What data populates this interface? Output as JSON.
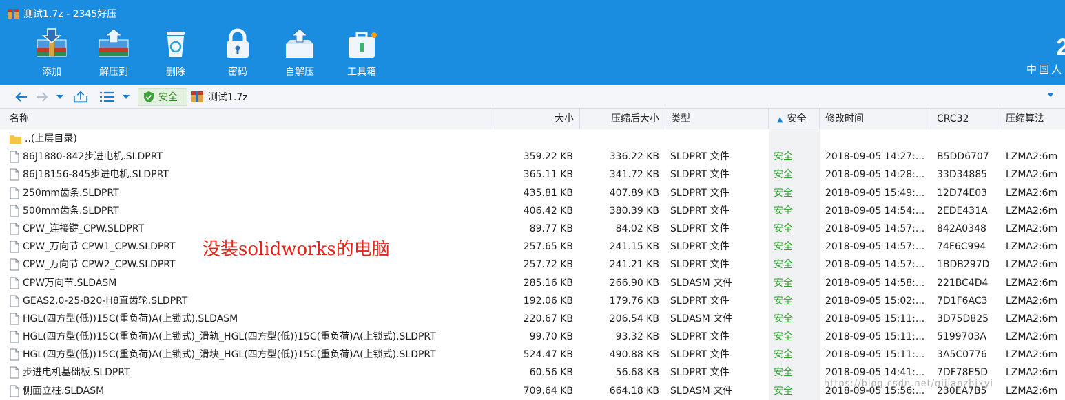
{
  "window": {
    "title": "测试1.7z - 2345好压"
  },
  "toolbar": {
    "buttons": [
      {
        "label": "添加",
        "icon": "add-archive-icon"
      },
      {
        "label": "解压到",
        "icon": "extract-to-icon"
      },
      {
        "label": "删除",
        "icon": "delete-icon"
      },
      {
        "label": "密码",
        "icon": "lock-icon"
      },
      {
        "label": "自解压",
        "icon": "self-extract-icon"
      },
      {
        "label": "工具箱",
        "icon": "toolbox-icon"
      }
    ]
  },
  "brand": {
    "number": "2",
    "text": "中国人"
  },
  "addressbar": {
    "safe_label": "安全",
    "path": "测试1.7z"
  },
  "columns": {
    "name": "名称",
    "size": "大小",
    "compressed": "压缩后大小",
    "type": "类型",
    "safety": "安全",
    "modified": "修改时间",
    "crc": "CRC32",
    "method": "压缩算法"
  },
  "parent_row": {
    "name": "..(上层目录)"
  },
  "rows": [
    {
      "name": "86J1880-842步进电机.SLDPRT",
      "size": "359.22 KB",
      "csize": "336.22 KB",
      "type": "SLDPRT 文件",
      "safe": "安全",
      "time": "2018-09-05 14:27:...",
      "crc": "B5DD6707",
      "method": "LZMA2:6m"
    },
    {
      "name": "86J18156-845步进电机.SLDPRT",
      "size": "365.11 KB",
      "csize": "341.72 KB",
      "type": "SLDPRT 文件",
      "safe": "安全",
      "time": "2018-09-05 14:28:...",
      "crc": "33D34885",
      "method": "LZMA2:6m"
    },
    {
      "name": "250mm齿条.SLDPRT",
      "size": "435.81 KB",
      "csize": "407.89 KB",
      "type": "SLDPRT 文件",
      "safe": "安全",
      "time": "2018-09-05 15:49:...",
      "crc": "12D74E03",
      "method": "LZMA2:6m"
    },
    {
      "name": "500mm齿条.SLDPRT",
      "size": "406.42 KB",
      "csize": "380.39 KB",
      "type": "SLDPRT 文件",
      "safe": "安全",
      "time": "2018-09-05 14:54:...",
      "crc": "2EDE431A",
      "method": "LZMA2:6m"
    },
    {
      "name": "CPW_连接键_CPW.SLDPRT",
      "size": "89.77 KB",
      "csize": "84.02 KB",
      "type": "SLDPRT 文件",
      "safe": "安全",
      "time": "2018-09-05 14:57:...",
      "crc": "842A0348",
      "method": "LZMA2:6m"
    },
    {
      "name": "CPW_万向节 CPW1_CPW.SLDPRT",
      "size": "257.65 KB",
      "csize": "241.15 KB",
      "type": "SLDPRT 文件",
      "safe": "安全",
      "time": "2018-09-05 14:57:...",
      "crc": "74F6C994",
      "method": "LZMA2:6m"
    },
    {
      "name": "CPW_万向节 CPW2_CPW.SLDPRT",
      "size": "257.72 KB",
      "csize": "241.21 KB",
      "type": "SLDPRT 文件",
      "safe": "安全",
      "time": "2018-09-05 14:57:...",
      "crc": "1BDB297D",
      "method": "LZMA2:6m"
    },
    {
      "name": "CPW万向节.SLDASM",
      "size": "285.16 KB",
      "csize": "266.90 KB",
      "type": "SLDASM 文件",
      "safe": "安全",
      "time": "2018-09-05 14:58:...",
      "crc": "221BC4D4",
      "method": "LZMA2:6m"
    },
    {
      "name": "GEAS2.0-25-B20-H8直齿轮.SLDPRT",
      "size": "192.06 KB",
      "csize": "179.76 KB",
      "type": "SLDPRT 文件",
      "safe": "安全",
      "time": "2018-09-05 15:02:...",
      "crc": "7D1F6AC3",
      "method": "LZMA2:6m"
    },
    {
      "name": "HGL(四方型(低))15C(重负荷)A(上锁式).SLDASM",
      "size": "220.67 KB",
      "csize": "206.54 KB",
      "type": "SLDASM 文件",
      "safe": "安全",
      "time": "2018-09-05 15:11:...",
      "crc": "3D75D825",
      "method": "LZMA2:6m"
    },
    {
      "name": "HGL(四方型(低))15C(重负荷)A(上锁式)_滑轨_HGL(四方型(低))15C(重负荷)A(上锁式).SLDPRT",
      "size": "99.70 KB",
      "csize": "93.32 KB",
      "type": "SLDPRT 文件",
      "safe": "安全",
      "time": "2018-09-05 15:11:...",
      "crc": "5199703A",
      "method": "LZMA2:6m"
    },
    {
      "name": "HGL(四方型(低))15C(重负荷)A(上锁式)_滑块_HGL(四方型(低))15C(重负荷)A(上锁式).SLDPRT",
      "size": "524.47 KB",
      "csize": "490.88 KB",
      "type": "SLDPRT 文件",
      "safe": "安全",
      "time": "2018-09-05 15:11:...",
      "crc": "3A5C0776",
      "method": "LZMA2:6m"
    },
    {
      "name": "步进电机基础板.SLDPRT",
      "size": "60.56 KB",
      "csize": "56.68 KB",
      "type": "SLDPRT 文件",
      "safe": "安全",
      "time": "2018-09-05 14:41:...",
      "crc": "7DF78E5D",
      "method": "LZMA2:6m"
    },
    {
      "name": "侧面立柱.SLDASM",
      "size": "709.64 KB",
      "csize": "664.18 KB",
      "type": "SLDASM 文件",
      "safe": "安全",
      "time": "2018-09-05 15:56:...",
      "crc": "230EA7B5",
      "method": "LZMA2:6m"
    }
  ],
  "annotation": "没装solidworks的电脑",
  "watermark": "https://blog.csdn.net/qijianzhixyi",
  "colors": {
    "header": "#1a8de0",
    "safe": "#28a428",
    "annotation": "#e8241a"
  }
}
